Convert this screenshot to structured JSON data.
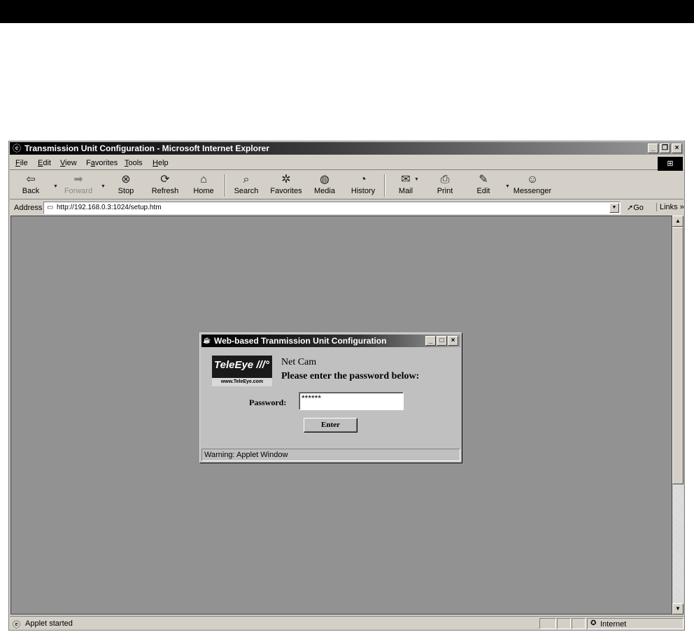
{
  "window": {
    "title": "Transmission Unit Configuration - Microsoft Internet Explorer",
    "controls": {
      "minimize": "_",
      "maximize": "🗗",
      "close": "×"
    }
  },
  "menu": [
    {
      "accel": "F",
      "rest": "ile"
    },
    {
      "accel": "E",
      "rest": "dit"
    },
    {
      "accel": "V",
      "rest": "iew"
    },
    {
      "pre": "F",
      "accel": "a",
      "rest": "vorites"
    },
    {
      "accel": "T",
      "rest": "ools"
    },
    {
      "accel": "H",
      "rest": "elp"
    }
  ],
  "toolbar": {
    "back": {
      "label": "Back",
      "icon": "back-arrow-icon"
    },
    "forward": {
      "label": "Forward",
      "icon": "forward-arrow-icon"
    },
    "stop": {
      "label": "Stop",
      "icon": "stop-icon"
    },
    "refresh": {
      "label": "Refresh",
      "icon": "refresh-icon"
    },
    "home": {
      "label": "Home",
      "icon": "home-icon"
    },
    "search": {
      "label": "Search",
      "icon": "search-icon"
    },
    "favorites": {
      "label": "Favorites",
      "icon": "favorites-icon"
    },
    "media": {
      "label": "Media",
      "icon": "media-icon"
    },
    "history": {
      "label": "History",
      "icon": "history-icon"
    },
    "mail": {
      "label": "Mail",
      "icon": "mail-icon"
    },
    "print": {
      "label": "Print",
      "icon": "print-icon"
    },
    "edit": {
      "label": "Edit",
      "icon": "edit-icon"
    },
    "messenger": {
      "label": "Messenger",
      "icon": "messenger-icon"
    }
  },
  "address": {
    "label": "Address",
    "url": "http://192.168.0.3:1024/setup.htm",
    "go": "Go",
    "links": "Links »"
  },
  "status": {
    "text": "Applet started",
    "zone": "Internet"
  },
  "applet": {
    "title": "Web-based Tranmission Unit Configuration",
    "logo_brand": "TeleEye ///°",
    "logo_site": "www.TeleEye.com",
    "product": "Net Cam",
    "prompt": "Please enter the password below:",
    "password_label": "Password:",
    "password_value": "******",
    "enter_label": "Enter",
    "warning": "Warning: Applet Window"
  }
}
